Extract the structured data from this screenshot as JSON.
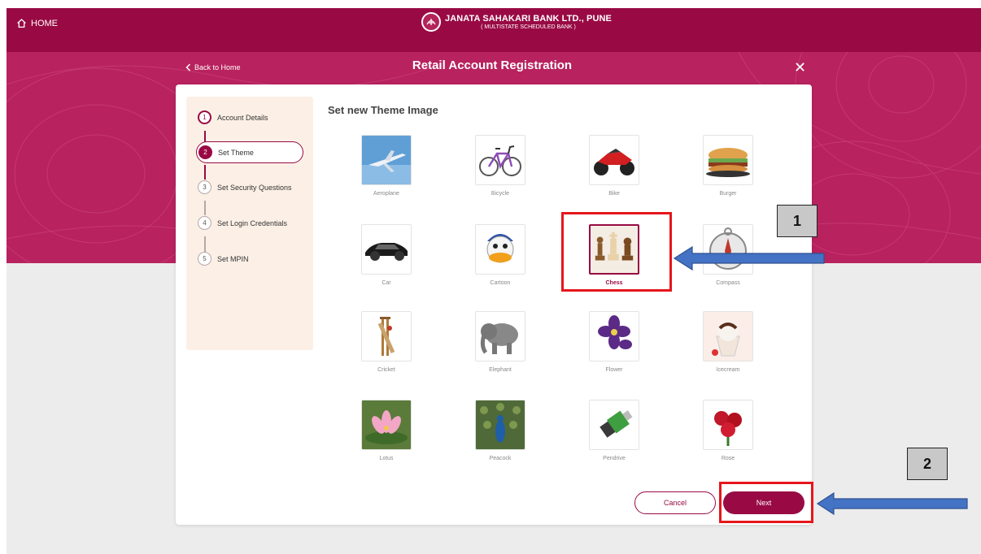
{
  "header": {
    "home_label": "HOME",
    "bank_name": "JANATA SAHAKARI BANK LTD., PUNE",
    "bank_subtitle": "( MULTISTATE SCHEDULED BANK )",
    "brand_color": "#990a44"
  },
  "page": {
    "back_label": "Back to Home",
    "title": "Retail Account Registration",
    "close_icon": "close-icon"
  },
  "steps": [
    {
      "num": "1",
      "label": "Account Details",
      "state": "done"
    },
    {
      "num": "2",
      "label": "Set Theme",
      "state": "active"
    },
    {
      "num": "3",
      "label": "Set Security Questions",
      "state": "pending"
    },
    {
      "num": "4",
      "label": "Set Login Credentials",
      "state": "pending"
    },
    {
      "num": "5",
      "label": "Set MPIN",
      "state": "pending"
    }
  ],
  "theme": {
    "title": "Set new Theme Image",
    "selected": "Chess",
    "images": [
      {
        "label": "Aeroplane"
      },
      {
        "label": "Bicycle"
      },
      {
        "label": "Bike"
      },
      {
        "label": "Burger"
      },
      {
        "label": "Car"
      },
      {
        "label": "Cartoon"
      },
      {
        "label": "Chess"
      },
      {
        "label": "Compass"
      },
      {
        "label": "Cricket"
      },
      {
        "label": "Elephant"
      },
      {
        "label": "Flower"
      },
      {
        "label": "Icecream"
      },
      {
        "label": "Lotus"
      },
      {
        "label": "Peacock"
      },
      {
        "label": "Pendrive"
      },
      {
        "label": "Rose"
      }
    ]
  },
  "buttons": {
    "cancel": "Cancel",
    "next": "Next"
  },
  "annotations": {
    "callout_1": "1",
    "callout_2": "2",
    "highlight_color": "#e6161c",
    "arrow_color": "#4472c4"
  }
}
